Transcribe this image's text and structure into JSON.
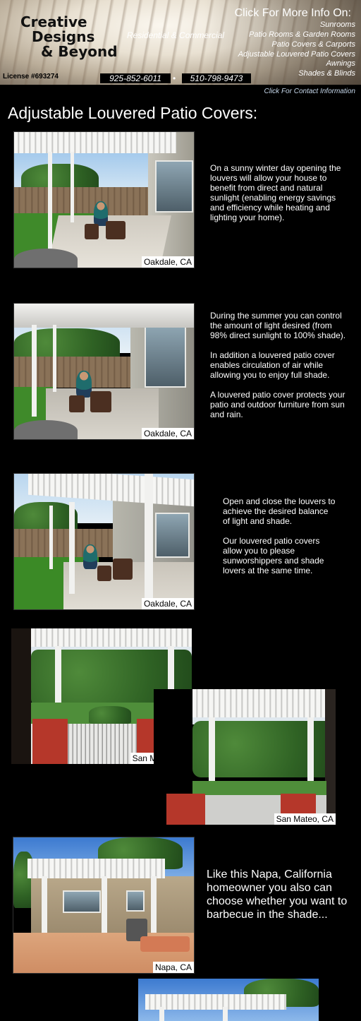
{
  "header": {
    "logo_lines": [
      "Creative",
      "Designs",
      "& Beyond"
    ],
    "license": "License #693274",
    "tagline": "Residential & Commercial",
    "click_more": "Click For More Info On:",
    "links": [
      "Sunrooms",
      "Patio Rooms & Garden Rooms",
      "Patio Covers & Carports",
      "Adjustable Louvered Patio Covers",
      "Awnings",
      "Shades & Blinds"
    ],
    "phone1": "925-852-6011",
    "separator": "•",
    "phone2": "510-798-9473",
    "contact_link": "Click For Contact Information"
  },
  "page_title": "Adjustable Louvered Patio Covers:",
  "sections": [
    {
      "caption": "Oakdale, CA",
      "paragraphs": [
        "On a sunny winter day opening the louvers will allow your house to benefit from direct and natural sunlight (enabling energy savings and efficiency while heating and lighting your home)."
      ]
    },
    {
      "caption": "Oakdale, CA",
      "paragraphs": [
        "During the summer you can control the amount of light desired (from 98% direct sunlight to 100% shade).",
        "In addition a louvered patio cover enables circulation of air while allowing you to enjoy full shade.",
        "A louvered patio cover protects your patio and outdoor furniture from sun and rain."
      ]
    },
    {
      "caption": "Oakdale, CA",
      "paragraphs": [
        "Open and close the louvers to achieve the desired balance of light and shade.",
        "Our louvered patio covers allow you to please sunworshippers and shade lovers at the same time."
      ]
    },
    {
      "caption": "San Mateo, CA"
    },
    {
      "caption": "San Mateo, CA"
    },
    {
      "caption": "Napa, CA",
      "paragraphs": [
        "Like this Napa, California homeowner you also can choose whether you want to barbecue in the shade..."
      ]
    }
  ],
  "colors": {
    "background": "#000000",
    "text": "#ffffff",
    "contact_link": "#c6d7ea",
    "caption_bg": "#ffffff"
  }
}
